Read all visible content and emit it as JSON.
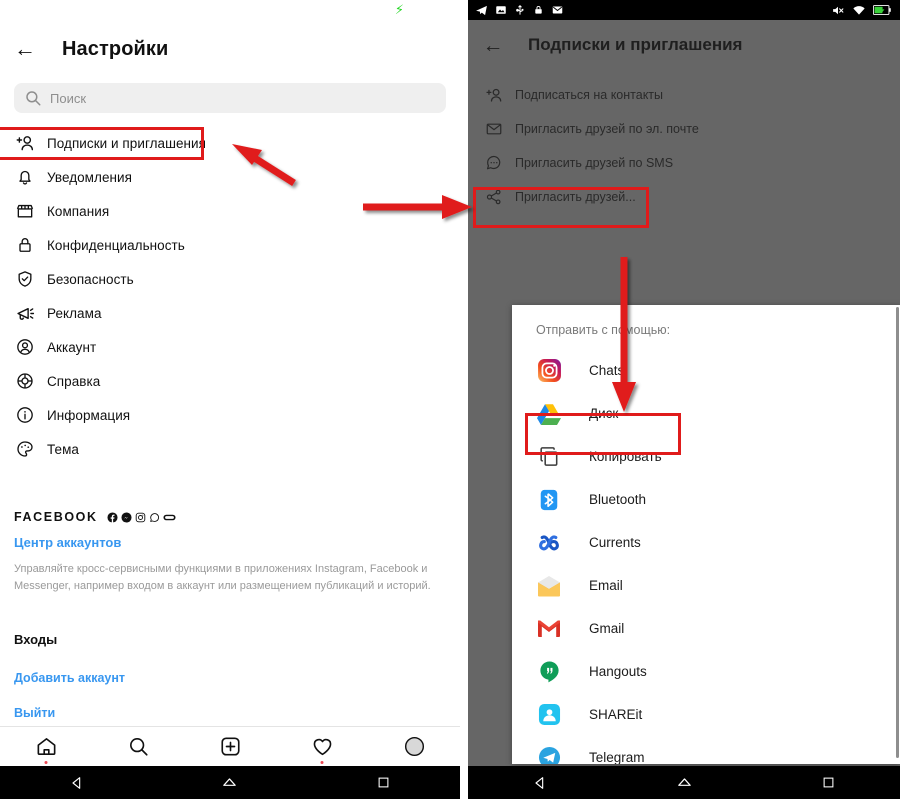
{
  "left_phone": {
    "statusbar": {
      "battery_icon": "bolt-charging-icon"
    },
    "header": {
      "back_icon": "back-arrow-icon",
      "title": "Настройки"
    },
    "search": {
      "icon": "search-icon",
      "placeholder": "Поиск"
    },
    "menu_items": [
      {
        "icon": "add-person-icon",
        "label": "Подписки и приглашения"
      },
      {
        "icon": "bell-icon",
        "label": "Уведомления"
      },
      {
        "icon": "storefront-icon",
        "label": "Компания"
      },
      {
        "icon": "lock-icon",
        "label": "Конфиденциальность"
      },
      {
        "icon": "shield-check-icon",
        "label": "Безопасность"
      },
      {
        "icon": "megaphone-icon",
        "label": "Реклама"
      },
      {
        "icon": "account-circle-icon",
        "label": "Аккаунт"
      },
      {
        "icon": "lifebuoy-icon",
        "label": "Справка"
      },
      {
        "icon": "info-circle-icon",
        "label": "Информация"
      },
      {
        "icon": "palette-icon",
        "label": "Тема"
      }
    ],
    "facebook_section": {
      "brand": "FACEBOOK",
      "glyph_icons": [
        "facebook-icon",
        "messenger-icon",
        "instagram-icon",
        "whatsapp-icon",
        "oculus-icon"
      ],
      "link": "Центр аккаунтов",
      "description": "Управляйте кросс-сервисными функциями в приложениях Instagram, Facebook и Messenger, например входом в аккаунт или размещением публикаций и историй."
    },
    "logins_section": {
      "title": "Входы",
      "add_account": "Добавить аккаунт",
      "logout": "Выйти"
    },
    "tabbar": [
      {
        "icon": "home-icon",
        "has_badge": true
      },
      {
        "icon": "search-icon",
        "has_badge": false
      },
      {
        "icon": "add-box-icon",
        "has_badge": false
      },
      {
        "icon": "heart-icon",
        "has_badge": true
      },
      {
        "icon": "profile-avatar-icon",
        "has_badge": false
      }
    ],
    "navbar": [
      {
        "icon": "android-back-icon"
      },
      {
        "icon": "android-home-icon"
      },
      {
        "icon": "android-recents-icon"
      }
    ]
  },
  "right_phone": {
    "statusbar": {
      "left_icons": [
        "telegram-icon",
        "screenshot-icon",
        "usb-icon",
        "lock-icon",
        "mail-icon"
      ],
      "right_icons": [
        "mute-icon",
        "wifi-icon",
        "battery-charging-icon"
      ]
    },
    "header": {
      "back_icon": "back-arrow-icon",
      "title": "Подписки и приглашения"
    },
    "menu_items": [
      {
        "icon": "add-person-icon",
        "label": "Подписаться на контакты"
      },
      {
        "icon": "envelope-icon",
        "label": "Пригласить друзей по эл. почте"
      },
      {
        "icon": "chat-bubble-icon",
        "label": "Пригласить друзей по SMS"
      },
      {
        "icon": "share-nodes-icon",
        "label": "Пригласить друзей..."
      }
    ],
    "share_sheet": {
      "title": "Отправить с помощью:",
      "apps": [
        {
          "icon": "instagram-icon",
          "label": "Chats"
        },
        {
          "icon": "google-drive-icon",
          "label": "Диск"
        },
        {
          "icon": "copy-icon",
          "label": "Копировать"
        },
        {
          "icon": "bluetooth-icon",
          "label": "Bluetooth"
        },
        {
          "icon": "currents-icon",
          "label": "Currents"
        },
        {
          "icon": "email-icon",
          "label": "Email"
        },
        {
          "icon": "gmail-icon",
          "label": "Gmail"
        },
        {
          "icon": "hangouts-icon",
          "label": "Hangouts"
        },
        {
          "icon": "shareit-icon",
          "label": "SHAREit"
        },
        {
          "icon": "telegram-icon",
          "label": "Telegram"
        }
      ]
    },
    "navbar": [
      {
        "icon": "android-back-icon"
      },
      {
        "icon": "android-home-icon"
      },
      {
        "icon": "android-recents-icon"
      }
    ]
  },
  "annotations": {
    "highlight_color": "#e01b1b",
    "boxes": [
      {
        "name": "highlight-subscriptions-menu-item"
      },
      {
        "name": "highlight-invite-friends-item"
      },
      {
        "name": "highlight-copy-item"
      }
    ],
    "arrows": [
      {
        "name": "arrow-to-subscriptions"
      },
      {
        "name": "arrow-to-invite-friends"
      },
      {
        "name": "arrow-to-copy"
      }
    ]
  }
}
